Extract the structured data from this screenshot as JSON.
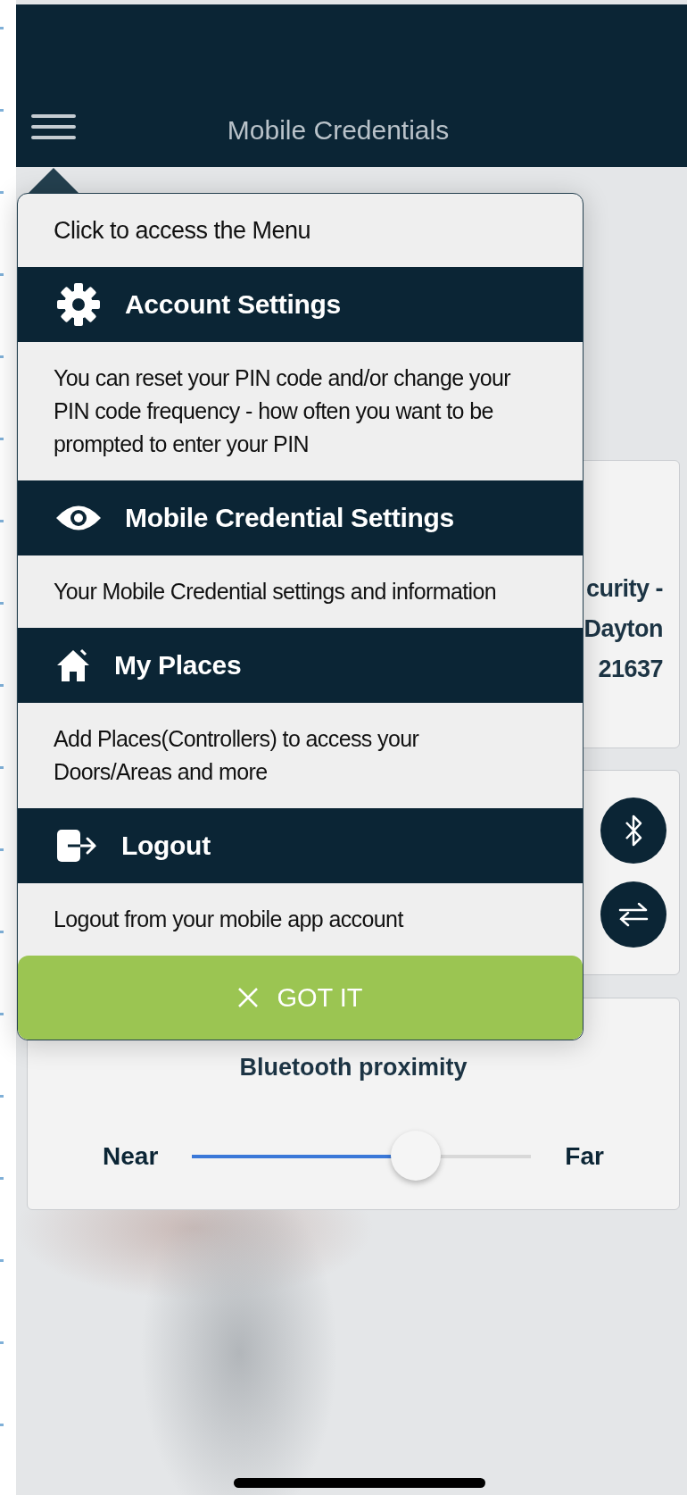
{
  "header": {
    "title": "Mobile Credentials"
  },
  "background": {
    "credential_card": {
      "lines": [
        "curity -",
        "Dayton",
        "21637"
      ]
    },
    "proximity_card": {
      "title": "Bluetooth proximity",
      "near_label": "Near",
      "far_label": "Far",
      "slider": {
        "level": 0.66
      }
    }
  },
  "coach_mark": {
    "intro": "Click to access the Menu",
    "sections": [
      {
        "kind": "gear",
        "title": "Account Settings",
        "description": "You can reset your PIN code and/or change your PIN code frequency - how often you want to be prompted to enter your PIN"
      },
      {
        "kind": "eye",
        "title": "Mobile Credential Settings",
        "description": "Your Mobile Credential settings and information"
      },
      {
        "kind": "home",
        "title": "My Places",
        "description": "Add Places(Controllers) to access your Doors/Areas and more"
      },
      {
        "kind": "logout",
        "title": "Logout",
        "description": "Logout from your mobile app account"
      }
    ],
    "dismiss_button": {
      "label": "GOT IT"
    }
  }
}
